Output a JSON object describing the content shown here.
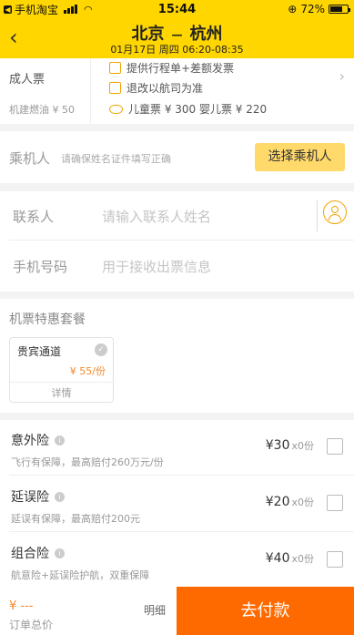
{
  "status_bar": {
    "carrier": "手机淘宝",
    "time": "15:44",
    "battery_pct": "72%",
    "battery_level": 0.72
  },
  "header": {
    "from": "北京",
    "to": "杭州",
    "subtitle": "01月17日 周四 06:20-08:35"
  },
  "info": {
    "adult": "成人票",
    "fuel": "机建燃油 ¥ 50",
    "items": [
      "提供行程单+差额发票",
      "退改以航司为准",
      "儿童票 ¥ 300 婴儿票 ¥ 220"
    ]
  },
  "passenger": {
    "label": "乘机人",
    "hint": "请确保姓名证件填写正确",
    "button": "选择乘机人"
  },
  "contact": {
    "name_label": "联系人",
    "name_placeholder": "请输入联系人姓名",
    "phone_label": "手机号码",
    "phone_placeholder": "用于接收出票信息"
  },
  "package": {
    "title": "机票特惠套餐",
    "item": {
      "name": "贵宾通道",
      "price": "¥ 55/份",
      "detail": "详情"
    }
  },
  "insurance": [
    {
      "name": "意外险",
      "desc": "飞行有保障，最高赔付260万元/份",
      "price": "¥30",
      "qty": "x0份"
    },
    {
      "name": "延误险",
      "desc": "延误有保障，最高赔付200元",
      "price": "¥20",
      "qty": "x0份"
    },
    {
      "name": "组合险",
      "desc": "航意险+延误险护航，双重保障",
      "price": "¥40",
      "qty": "x0份"
    }
  ],
  "bottom": {
    "total": "¥ ---",
    "total_label": "订单总价",
    "detail": "明细",
    "pay": "去付款"
  }
}
